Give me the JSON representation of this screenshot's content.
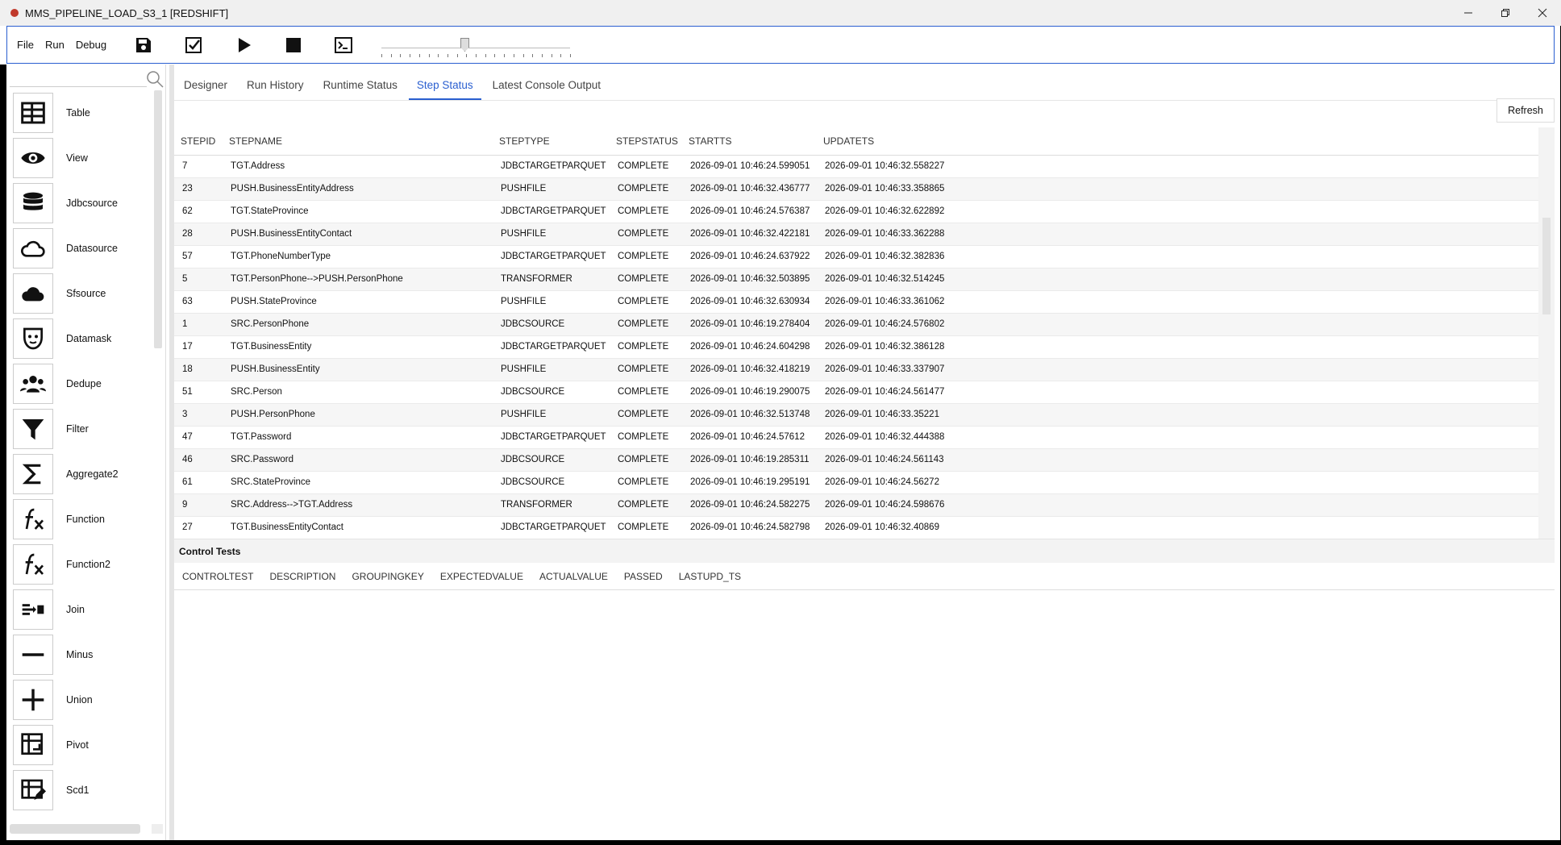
{
  "window": {
    "title": "MMS_PIPELINE_LOAD_S3_1 [REDSHIFT]",
    "controls": [
      "minimize",
      "restore",
      "close"
    ]
  },
  "toolbar": {
    "menu": [
      "File",
      "Run",
      "Debug"
    ],
    "icons": [
      "save-icon",
      "validate-icon",
      "run-icon",
      "stop-icon",
      "console-icon"
    ],
    "slider_level": 0.44
  },
  "palette": {
    "items": [
      {
        "label": "Table",
        "icon": "table-icon"
      },
      {
        "label": "View",
        "icon": "eye-icon"
      },
      {
        "label": "Jdbcsource",
        "icon": "database-icon"
      },
      {
        "label": "Datasource",
        "icon": "cloud-outline-icon"
      },
      {
        "label": "Sfsource",
        "icon": "cloud-filled-icon"
      },
      {
        "label": "Datamask",
        "icon": "mask-icon"
      },
      {
        "label": "Dedupe",
        "icon": "people-icon"
      },
      {
        "label": "Filter",
        "icon": "filter-icon"
      },
      {
        "label": "Aggregate2",
        "icon": "sigma-icon"
      },
      {
        "label": "Function",
        "icon": "function-icon"
      },
      {
        "label": "Function2",
        "icon": "function-icon"
      },
      {
        "label": "Join",
        "icon": "join-icon"
      },
      {
        "label": "Minus",
        "icon": "minus-icon"
      },
      {
        "label": "Union",
        "icon": "plus-icon"
      },
      {
        "label": "Pivot",
        "icon": "pivot-icon"
      },
      {
        "label": "Scd1",
        "icon": "edit-table-icon"
      }
    ]
  },
  "tabs": [
    {
      "label": "Designer",
      "active": false
    },
    {
      "label": "Run History",
      "active": false
    },
    {
      "label": "Runtime Status",
      "active": false
    },
    {
      "label": "Step Status",
      "active": true
    },
    {
      "label": "Latest Console Output",
      "active": false
    }
  ],
  "refresh_label": "Refresh",
  "step_status": {
    "columns": [
      "STEPID",
      "STEPNAME",
      "STEPTYPE",
      "STEPSTATUS",
      "STARTTS",
      "UPDATETS"
    ],
    "rows": [
      [
        "7",
        "TGT.Address",
        "JDBCTARGETPARQUET",
        "COMPLETE",
        "2026-09-01 10:46:24.599051",
        "2026-09-01 10:46:32.558227"
      ],
      [
        "23",
        "PUSH.BusinessEntityAddress",
        "PUSHFILE",
        "COMPLETE",
        "2026-09-01 10:46:32.436777",
        "2026-09-01 10:46:33.358865"
      ],
      [
        "62",
        "TGT.StateProvince",
        "JDBCTARGETPARQUET",
        "COMPLETE",
        "2026-09-01 10:46:24.576387",
        "2026-09-01 10:46:32.622892"
      ],
      [
        "28",
        "PUSH.BusinessEntityContact",
        "PUSHFILE",
        "COMPLETE",
        "2026-09-01 10:46:32.422181",
        "2026-09-01 10:46:33.362288"
      ],
      [
        "57",
        "TGT.PhoneNumberType",
        "JDBCTARGETPARQUET",
        "COMPLETE",
        "2026-09-01 10:46:24.637922",
        "2026-09-01 10:46:32.382836"
      ],
      [
        "5",
        "TGT.PersonPhone-->PUSH.PersonPhone",
        "TRANSFORMER",
        "COMPLETE",
        "2026-09-01 10:46:32.503895",
        "2026-09-01 10:46:32.514245"
      ],
      [
        "63",
        "PUSH.StateProvince",
        "PUSHFILE",
        "COMPLETE",
        "2026-09-01 10:46:32.630934",
        "2026-09-01 10:46:33.361062"
      ],
      [
        "1",
        "SRC.PersonPhone",
        "JDBCSOURCE",
        "COMPLETE",
        "2026-09-01 10:46:19.278404",
        "2026-09-01 10:46:24.576802"
      ],
      [
        "17",
        "TGT.BusinessEntity",
        "JDBCTARGETPARQUET",
        "COMPLETE",
        "2026-09-01 10:46:24.604298",
        "2026-09-01 10:46:32.386128"
      ],
      [
        "18",
        "PUSH.BusinessEntity",
        "PUSHFILE",
        "COMPLETE",
        "2026-09-01 10:46:32.418219",
        "2026-09-01 10:46:33.337907"
      ],
      [
        "51",
        "SRC.Person",
        "JDBCSOURCE",
        "COMPLETE",
        "2026-09-01 10:46:19.290075",
        "2026-09-01 10:46:24.561477"
      ],
      [
        "3",
        "PUSH.PersonPhone",
        "PUSHFILE",
        "COMPLETE",
        "2026-09-01 10:46:32.513748",
        "2026-09-01 10:46:33.35221"
      ],
      [
        "47",
        "TGT.Password",
        "JDBCTARGETPARQUET",
        "COMPLETE",
        "2026-09-01 10:46:24.57612",
        "2026-09-01 10:46:32.444388"
      ],
      [
        "46",
        "SRC.Password",
        "JDBCSOURCE",
        "COMPLETE",
        "2026-09-01 10:46:19.285311",
        "2026-09-01 10:46:24.561143"
      ],
      [
        "61",
        "SRC.StateProvince",
        "JDBCSOURCE",
        "COMPLETE",
        "2026-09-01 10:46:19.295191",
        "2026-09-01 10:46:24.56272"
      ],
      [
        "9",
        "SRC.Address-->TGT.Address",
        "TRANSFORMER",
        "COMPLETE",
        "2026-09-01 10:46:24.582275",
        "2026-09-01 10:46:24.598676"
      ],
      [
        "27",
        "TGT.BusinessEntityContact",
        "JDBCTARGETPARQUET",
        "COMPLETE",
        "2026-09-01 10:46:24.582798",
        "2026-09-01 10:46:32.40869"
      ]
    ]
  },
  "control_tests": {
    "title": "Control Tests",
    "columns": [
      "CONTROLTEST",
      "DESCRIPTION",
      "GROUPINGKEY",
      "EXPECTEDVALUE",
      "ACTUALVALUE",
      "PASSED",
      "LASTUPD_TS"
    ]
  },
  "colors": {
    "accent": "#2a5fd0",
    "app_dot": "#c0392b"
  }
}
